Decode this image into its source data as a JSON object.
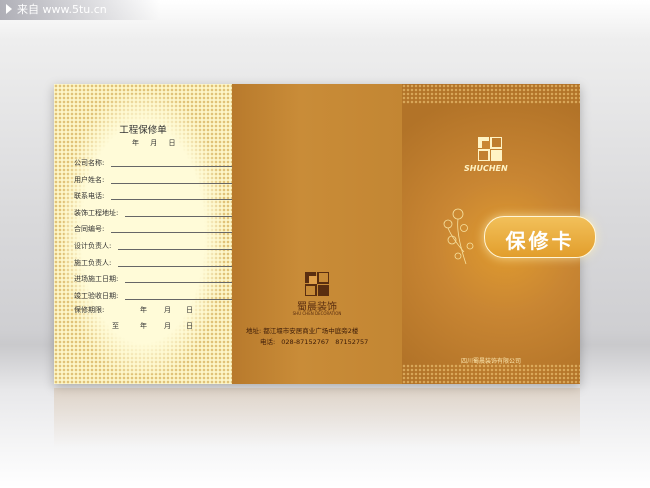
{
  "watermark": {
    "text": "来自 www.5tu.cn"
  },
  "form": {
    "title": "工程保修单",
    "date_label": "年 月 日",
    "fields": [
      "公司名称:",
      "用户姓名:",
      "联系电话:",
      "装饰工程地址:",
      "合同编号:",
      "设计负责人:",
      "施工负责人:",
      "进场施工日期:",
      "竣工验收日期:"
    ],
    "warranty_label": "保修期限:",
    "warranty_to": "至",
    "date_units": [
      "年",
      "月",
      "日"
    ]
  },
  "middle": {
    "brand": "蜀晨装饰",
    "brand_sub": "SHU CHEN DECORATION",
    "address": "地址: 都江堰市安居商业广场中庭旁2楼",
    "tel_label": "电话:",
    "tel1": "028-87152767",
    "tel2": "87152757"
  },
  "cover": {
    "brand": "SHUCHEN",
    "title": "保修卡",
    "company": "四川蜀晨装饰有限公司"
  },
  "colors": {
    "cover_gold": "#c98633",
    "form_bg": "#fdf6c9",
    "brand_dark": "#5a2e10"
  }
}
